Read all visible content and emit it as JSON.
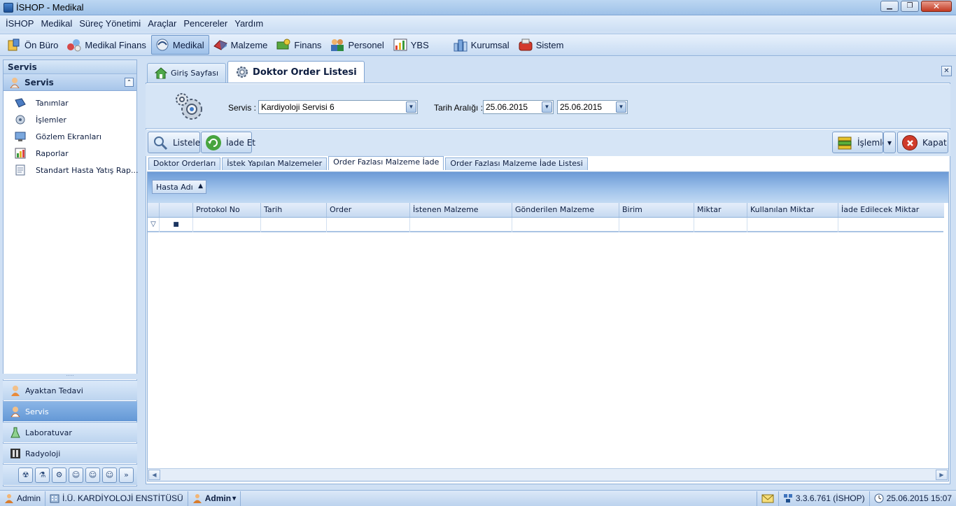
{
  "window": {
    "title": "İSHOP - Medikal",
    "min": "▁",
    "max": "❐",
    "close": "✕"
  },
  "menu": [
    "İSHOP",
    "Medikal",
    "Süreç Yönetimi",
    "Araçlar",
    "Pencereler",
    "Yardım"
  ],
  "modules": [
    {
      "label": "Ön Büro",
      "icon": "front-office-icon"
    },
    {
      "label": "Medikal Finans",
      "icon": "medical-finance-icon"
    },
    {
      "label": "Medikal",
      "icon": "medical-icon",
      "active": true
    },
    {
      "label": "Malzeme",
      "icon": "material-icon"
    },
    {
      "label": "Finans",
      "icon": "finance-icon"
    },
    {
      "label": "Personel",
      "icon": "personnel-icon"
    },
    {
      "label": "YBS",
      "icon": "ybs-chart-icon"
    },
    {
      "label": "Kurumsal",
      "icon": "corporate-icon"
    },
    {
      "label": "Sistem",
      "icon": "system-icon"
    }
  ],
  "sidebar": {
    "header": "Servis",
    "group": "Servis",
    "collapse": "⌃",
    "items": [
      {
        "label": "Tanımlar",
        "icon": "definitions-icon"
      },
      {
        "label": "İşlemler",
        "icon": "operations-icon"
      },
      {
        "label": "Gözlem Ekranları",
        "icon": "observation-icon"
      },
      {
        "label": "Raporlar",
        "icon": "reports-icon"
      },
      {
        "label": "Standart Hasta Yatış Rap...",
        "icon": "patient-report-icon"
      }
    ],
    "splitter": "·····",
    "nav": [
      {
        "label": "Ayaktan Tedavi",
        "icon": "outpatient-icon"
      },
      {
        "label": "Servis",
        "icon": "service-icon",
        "selected": true
      },
      {
        "label": "Laboratuvar",
        "icon": "laboratory-icon"
      },
      {
        "label": "Radyoloji",
        "icon": "radiology-icon"
      }
    ],
    "mini_buttons": [
      "☢",
      "⚗",
      "⚙",
      "☺",
      "☺",
      "☺",
      "»"
    ]
  },
  "doc_tabs": [
    {
      "label": "Giriş Sayfası",
      "icon": "home-icon"
    },
    {
      "label": "Doktor Order Listesi",
      "icon": "settings-gear-icon",
      "active": true
    }
  ],
  "doc_close": "✕",
  "filter": {
    "servis_label": "Servis :",
    "servis_value": "Kardiyoloji Servisi 6",
    "tarih_label": "Tarih Aralığı :",
    "date_from": "25.06.2015",
    "date_to": "25.06.2015",
    "dd_arrow": "▼"
  },
  "buttons": {
    "listele": "Listele",
    "iade_et": "İade Et",
    "islemler": "İşlemler",
    "islemler_dd": "▾",
    "kapat": "Kapat"
  },
  "sub_tabs": [
    "Doktor Orderları",
    "İstek Yapılan Malzemeler",
    "Order Fazlası Malzeme İade",
    "Order Fazlası Malzeme İade Listesi"
  ],
  "active_sub_tab": 2,
  "grid": {
    "group_by": "Hasta Adı",
    "group_arrow": "▲",
    "columns": [
      "",
      "",
      "Protokol No",
      "Tarih",
      "Order",
      "İstenen Malzeme",
      "Gönderilen Malzeme",
      "Birim",
      "Miktar",
      "Kullanılan Miktar",
      "İade Edilecek Miktar"
    ],
    "filter_icon": "▽",
    "checkbox": "■",
    "scroll_left": "◀",
    "scroll_right": "▶"
  },
  "status": {
    "user": "Admin",
    "institution": "İ.Ü. KARDİYOLOJİ ENSTİTÜSÜ",
    "role": "Admin",
    "role_arrow": "▾",
    "version": "3.3.6.761 (İSHOP)",
    "datetime": "25.06.2015 15:07"
  },
  "colors": {
    "accent": "#6c9ad6",
    "selected_nav": "#6498d6",
    "close_red": "#c23a22"
  }
}
